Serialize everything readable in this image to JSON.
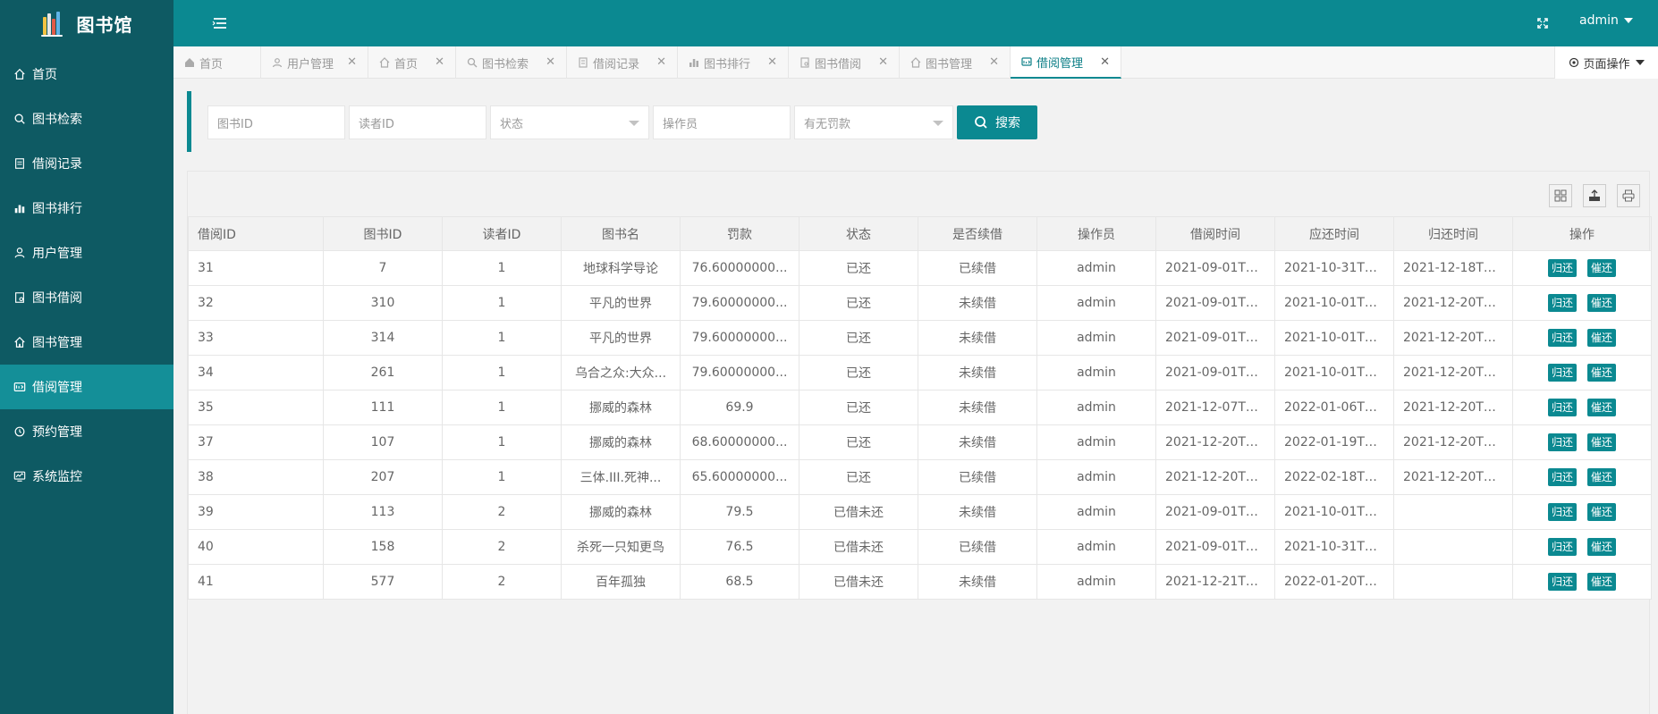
{
  "app": {
    "title": "图书馆"
  },
  "sidebar": {
    "items": [
      {
        "label": "首页",
        "icon": "home-icon"
      },
      {
        "label": "图书检索",
        "icon": "search-icon"
      },
      {
        "label": "借阅记录",
        "icon": "record-icon"
      },
      {
        "label": "图书排行",
        "icon": "bar-chart-icon"
      },
      {
        "label": "用户管理",
        "icon": "user-icon"
      },
      {
        "label": "图书借阅",
        "icon": "borrow-icon"
      },
      {
        "label": "图书管理",
        "icon": "home-manage-icon"
      },
      {
        "label": "借阅管理",
        "icon": "borrow-manage-icon"
      },
      {
        "label": "预约管理",
        "icon": "reserve-icon"
      },
      {
        "label": "系统监控",
        "icon": "monitor-icon"
      }
    ]
  },
  "header": {
    "user": "admin"
  },
  "tabs": [
    {
      "label": "首页"
    },
    {
      "label": "用户管理"
    },
    {
      "label": "首页"
    },
    {
      "label": "图书检索"
    },
    {
      "label": "借阅记录"
    },
    {
      "label": "图书排行"
    },
    {
      "label": "图书借阅"
    },
    {
      "label": "图书管理"
    },
    {
      "label": "借阅管理"
    }
  ],
  "page_ops": "页面操作",
  "search": {
    "book_id_placeholder": "图书ID",
    "reader_id_placeholder": "读者ID",
    "status_placeholder": "状态",
    "operator_placeholder": "操作员",
    "fine_placeholder": "有无罚款",
    "button": "搜索"
  },
  "table": {
    "headers": [
      "借阅ID",
      "图书ID",
      "读者ID",
      "图书名",
      "罚款",
      "状态",
      "是否续借",
      "操作员",
      "借阅时间",
      "应还时间",
      "归还时间",
      "操作"
    ],
    "actions": {
      "return": "归还",
      "remind": "催还"
    },
    "rows": [
      [
        "31",
        "7",
        "1",
        "地球科学导论",
        "76.60000000...",
        "已还",
        "已续借",
        "admin",
        "2021-09-01T1...",
        "2021-10-31T1...",
        "2021-12-18T1..."
      ],
      [
        "32",
        "310",
        "1",
        "平凡的世界",
        "79.60000000...",
        "已还",
        "未续借",
        "admin",
        "2021-09-01T1...",
        "2021-10-01T1...",
        "2021-12-20T2..."
      ],
      [
        "33",
        "314",
        "1",
        "平凡的世界",
        "79.60000000...",
        "已还",
        "未续借",
        "admin",
        "2021-09-01T1...",
        "2021-10-01T1...",
        "2021-12-20T2..."
      ],
      [
        "34",
        "261",
        "1",
        "乌合之众:大众...",
        "79.60000000...",
        "已还",
        "未续借",
        "admin",
        "2021-09-01T1...",
        "2021-10-01T1...",
        "2021-12-20T2..."
      ],
      [
        "35",
        "111",
        "1",
        "挪威的森林",
        "69.9",
        "已还",
        "未续借",
        "admin",
        "2021-12-07T1...",
        "2022-01-06T1...",
        "2021-12-20T2..."
      ],
      [
        "37",
        "107",
        "1",
        "挪威的森林",
        "68.60000000...",
        "已还",
        "未续借",
        "admin",
        "2021-12-20T1...",
        "2022-01-19T1...",
        "2021-12-20T1..."
      ],
      [
        "38",
        "207",
        "1",
        "三体.III.死神...",
        "65.60000000...",
        "已还",
        "已续借",
        "admin",
        "2021-12-20T1...",
        "2022-02-18T1...",
        "2021-12-20T1..."
      ],
      [
        "39",
        "113",
        "2",
        "挪威的森林",
        "79.5",
        "已借未还",
        "未续借",
        "admin",
        "2021-09-01T2...",
        "2021-10-01T2...",
        ""
      ],
      [
        "40",
        "158",
        "2",
        "杀死一只知更鸟",
        "76.5",
        "已借未还",
        "已续借",
        "admin",
        "2021-09-01T2...",
        "2021-10-31T2...",
        ""
      ],
      [
        "41",
        "577",
        "2",
        "百年孤独",
        "68.5",
        "已借未还",
        "未续借",
        "admin",
        "2021-12-21T1...",
        "2022-01-20T1...",
        ""
      ]
    ]
  },
  "colors": {
    "sidebar": "#0e5a63",
    "header": "#0b8991",
    "accent": "#0b8991",
    "active_nav": "#148f98"
  }
}
